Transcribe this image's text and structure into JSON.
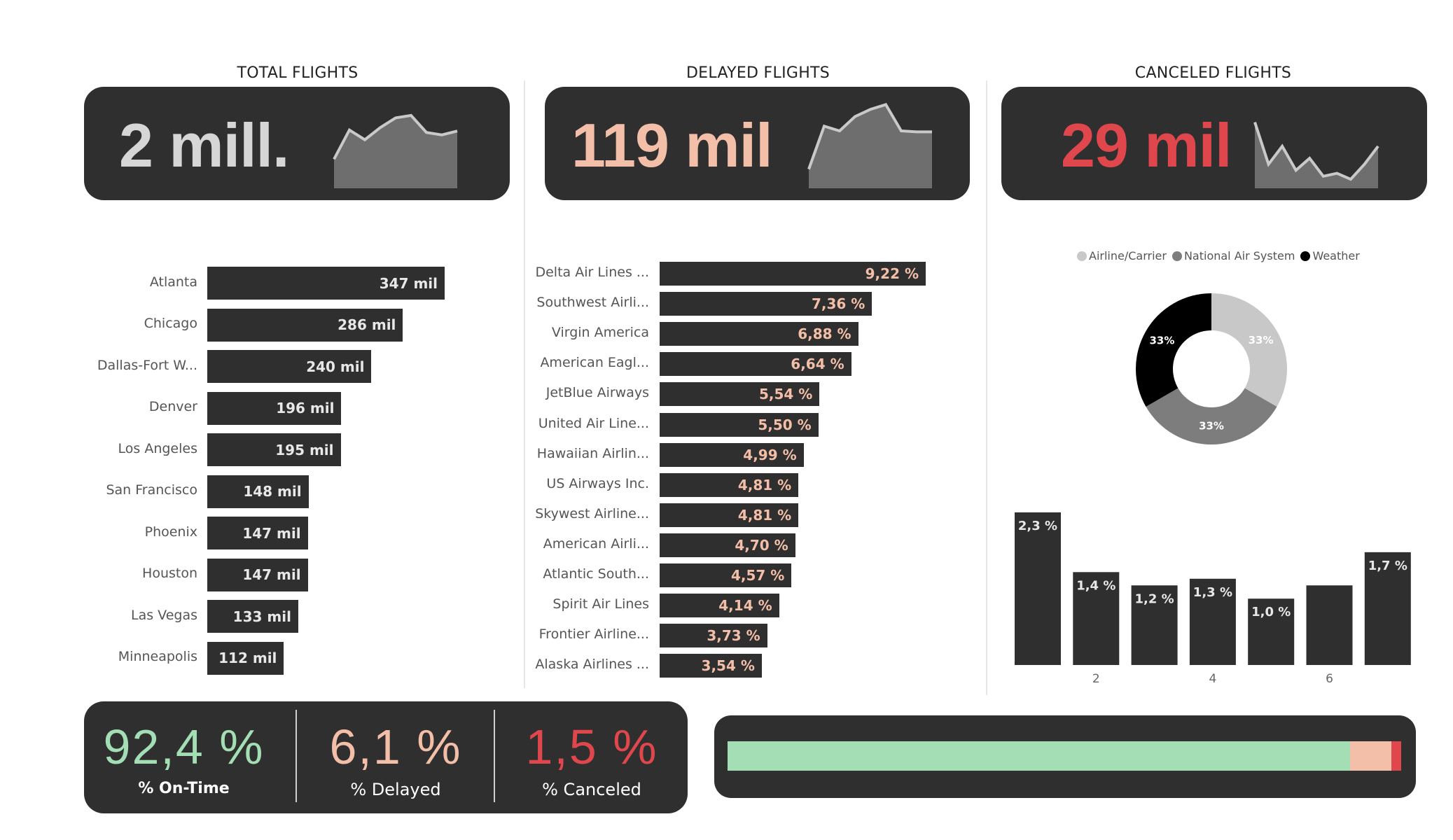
{
  "headers": {
    "total": "TOTAL FLIGHTS",
    "delayed": "DELAYED FLIGHTS",
    "canceled": "CANCELED FLIGHTS"
  },
  "kpis": {
    "total": "2 mill.",
    "delayed": "119 mil",
    "canceled": "29 mil"
  },
  "colors": {
    "card": "#2f2f2f",
    "total_value": "#d6d6d6",
    "delayed_value": "#f3bfa8",
    "canceled_value": "#e0474c",
    "on_time": "#a3deb4",
    "sparkline_fill": "#6e6e6e",
    "sparkline_line": "#c9c9c9"
  },
  "percentages": {
    "on_time": {
      "value": "92,4 %",
      "label": "% On-Time"
    },
    "delayed": {
      "value": "6,1 %",
      "label": "% Delayed"
    },
    "canceled": {
      "value": "1,5 %",
      "label": "% Canceled"
    }
  },
  "chart_data": [
    {
      "type": "line",
      "name": "total_sparkline",
      "values": [
        60,
        120,
        100,
        125,
        145,
        150,
        115,
        110,
        118
      ],
      "ylim": [
        0,
        160
      ]
    },
    {
      "type": "line",
      "name": "delayed_sparkline",
      "values": [
        40,
        130,
        120,
        150,
        165,
        175,
        120,
        118,
        118
      ],
      "ylim": [
        0,
        180
      ]
    },
    {
      "type": "line",
      "name": "canceled_sparkline",
      "values": [
        110,
        40,
        70,
        30,
        50,
        20,
        25,
        15,
        40,
        70
      ],
      "ylim": [
        0,
        120
      ]
    },
    {
      "type": "bar",
      "name": "flights_by_city",
      "categories": [
        "Atlanta",
        "Chicago",
        "Dallas-Fort W...",
        "Denver",
        "Los Angeles",
        "San Francisco",
        "Phoenix",
        "Houston",
        "Las Vegas",
        "Minneapolis"
      ],
      "values": [
        347,
        286,
        240,
        196,
        195,
        148,
        147,
        147,
        133,
        112
      ],
      "labels": [
        "347 mil",
        "286 mil",
        "240 mil",
        "196 mil",
        "195 mil",
        "148 mil",
        "147 mil",
        "147 mil",
        "133 mil",
        "112 mil"
      ],
      "xlim": [
        0,
        347
      ]
    },
    {
      "type": "bar",
      "name": "delay_by_airline",
      "categories": [
        "Delta Air Lines ...",
        "Southwest Airli...",
        "Virgin America",
        "American Eagl...",
        "JetBlue Airways",
        "United Air Line...",
        "Hawaiian Airlin...",
        "US Airways Inc.",
        "Skywest Airline...",
        "American Airli...",
        "Atlantic South...",
        "Spirit Air Lines",
        "Frontier Airline...",
        "Alaska Airlines ..."
      ],
      "values": [
        9.22,
        7.36,
        6.88,
        6.64,
        5.54,
        5.5,
        4.99,
        4.81,
        4.81,
        4.7,
        4.57,
        4.14,
        3.73,
        3.54
      ],
      "labels": [
        "9,22 %",
        "7,36 %",
        "6,88 %",
        "6,64 %",
        "5,54 %",
        "5,50 %",
        "4,99 %",
        "4,81 %",
        "4,81 %",
        "4,70 %",
        "4,57 %",
        "4,14 %",
        "3,73 %",
        "3,54 %"
      ],
      "xlim": [
        0,
        9.22
      ]
    },
    {
      "type": "pie",
      "name": "cancel_reasons",
      "legend": [
        "Airline/Carrier",
        "National Air System",
        "Weather"
      ],
      "values": [
        33.33,
        33.33,
        33.34
      ],
      "labels": [
        "33%",
        "33%",
        "33%"
      ],
      "colors": [
        "#c8c8c8",
        "#7d7d7d",
        "#000000"
      ]
    },
    {
      "type": "bar",
      "name": "cancel_rate_by_day",
      "categories": [
        1,
        2,
        3,
        4,
        5,
        6,
        7
      ],
      "values": [
        2.3,
        1.4,
        1.2,
        1.3,
        1.0,
        1.2,
        1.7
      ],
      "labels": [
        "2,3 %",
        "1,4 %",
        "1,2 %",
        "1,3 %",
        "1,0 %",
        "",
        "1,7 %"
      ],
      "tick_labels": [
        "2",
        "4",
        "6"
      ],
      "ylim": [
        0,
        2.3
      ]
    },
    {
      "type": "bar",
      "name": "status_split",
      "values": [
        92.4,
        6.1,
        1.5
      ],
      "colors": [
        "#a3deb4",
        "#f3bfa8",
        "#e0474c"
      ]
    }
  ]
}
